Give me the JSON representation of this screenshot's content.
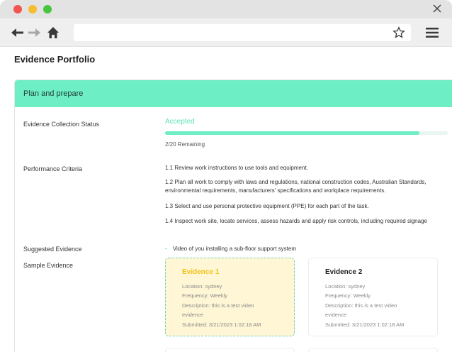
{
  "page": {
    "title": "Evidence Portfolio"
  },
  "section": {
    "title": "Plan and prepare"
  },
  "status": {
    "label": "Evidence Collection Status",
    "value": "Accepted",
    "progress_fraction": 0.9,
    "remaining": "2/20 Remaining"
  },
  "criteria": {
    "label": "Performance Criteria",
    "items": [
      "1.1 Review work instructions to use tools and equipment.",
      "1.2 Plan all work to comply with laws and regulations, national construction codes, Australian Standards,",
      "environmental requirements, manufacturers' specifications and workplace requirements.",
      "1.3 Select and use personal protective equipment (PPE) for each part of the task.",
      "1.4 Inspect work site, locate services, assess hazards and apply risk controls, including required signage"
    ]
  },
  "suggested": {
    "label": "Suggested Evidence",
    "item": "Video of you installing a sub-floor support system"
  },
  "sample": {
    "label": "Sample Evidence",
    "cards": [
      {
        "title": "Evidence 1",
        "location": "Location: sydney",
        "frequency": "Frequency: Weekly",
        "description_1": "Description: this is a test video",
        "description_2": "evidence",
        "submitted": "Submitted: 3/21/2023 1:02:18 AM"
      },
      {
        "title": "Evidence 2",
        "location": "Location: sydney",
        "frequency": "Frequency: Weekly",
        "description_1": "Description: this is a test video",
        "description_2": "evidence",
        "submitted": "Submitted: 3/21/2023 1:02:18 AM"
      }
    ]
  },
  "colors": {
    "accent": "#6eeec4",
    "selected_bg": "#fff6d5",
    "selected_title": "#f1c21b"
  },
  "icons": [
    "close-icon",
    "back-arrow-icon",
    "forward-arrow-icon",
    "home-icon",
    "star-icon",
    "menu-icon"
  ]
}
